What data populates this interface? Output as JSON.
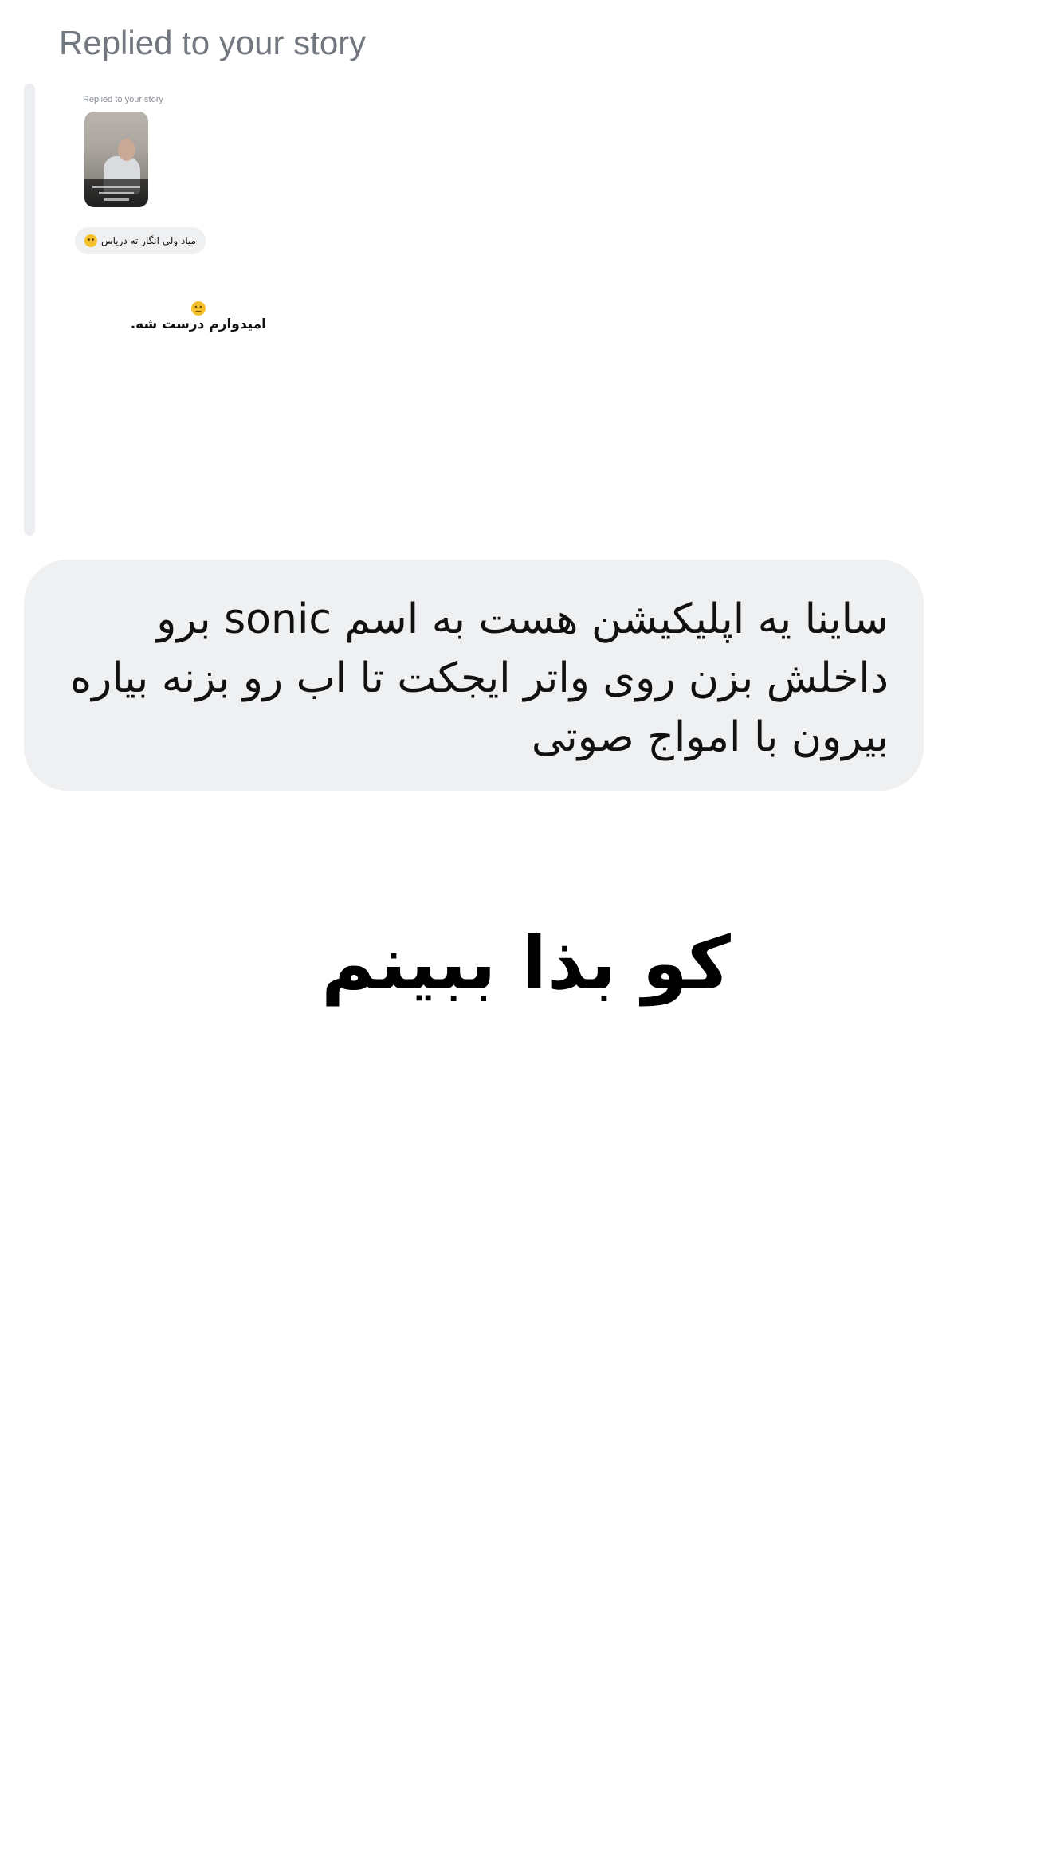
{
  "header": {
    "reply_label": "Replied to your story"
  },
  "quoted_story": {
    "inner_label": "Replied to your story",
    "inner_message": "میاد ولی انگار ته دریاس",
    "story_text": "امیدوارم درست شه."
  },
  "message_bubble": {
    "lines": [
      "ساینا یه اپلیکیشن هست به اسم sonic برو",
      "داخلش بزن روی واتر ایجکت تا اب رو بزنه بیاره",
      "بیرون با امواج صوتی"
    ]
  },
  "overlay_text": "کو بذا ببینم",
  "colors": {
    "bubble_bg": "#eff0f2",
    "label_gray": "#737880",
    "background": "#ffffff"
  },
  "icons": [
    "smiling-face-emoji-icon",
    "neutral-face-emoji-icon"
  ]
}
